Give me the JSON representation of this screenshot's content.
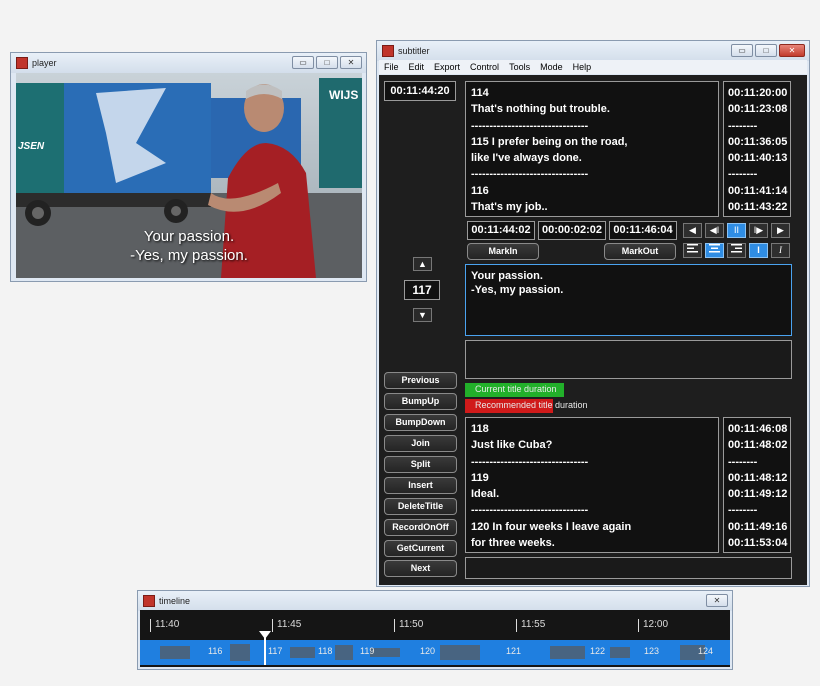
{
  "player": {
    "title": "player",
    "subtitle_lines": [
      "Your passion.",
      "-Yes, my passion."
    ],
    "truck_sign_1": "JSEN",
    "truck_sign_2": "WIJS"
  },
  "subtitler": {
    "title": "subtitler",
    "menu": [
      "File",
      "Edit",
      "Export",
      "Control",
      "Tools",
      "Mode",
      "Help"
    ],
    "current_time": "00:11:44:20",
    "prev_text_lines": [
      "114",
      "That's nothing but trouble.",
      "--------------------------------",
      "115 I prefer being on the road,",
      "like I've always done.",
      "--------------------------------",
      "116",
      "That's my job.."
    ],
    "prev_timecodes": [
      "00:11:20:00",
      "00:11:23:08",
      "--------",
      "00:11:36:05",
      "00:11:40:13",
      "--------",
      "00:11:41:14",
      "00:11:43:22"
    ],
    "mark_in": "00:11:44:02",
    "duration": "00:00:02:02",
    "mark_out": "00:11:46:04",
    "markin_label": "MarkIn",
    "markout_label": "MarkOut",
    "transport_icons": [
      "◀",
      "◀I",
      "II",
      "I▶",
      "▶"
    ],
    "align_icons": [
      "align-left-icon",
      "align-center-icon",
      "align-right-icon",
      "bold-icon",
      "italic-icon"
    ],
    "title_number": "117",
    "edit_text": "Your passion.\n-Yes, my passion.",
    "current_duration_label": "Current title duration",
    "recommended_duration_label": "Recommended title duration",
    "current_duration_fraction": 0.62,
    "recommended_duration_fraction": 0.88,
    "buttons": [
      "Previous",
      "BumpUp",
      "BumpDown",
      "Join",
      "Split",
      "Insert",
      "DeleteTitle",
      "RecordOnOff",
      "GetCurrent",
      "Next"
    ],
    "next_text_lines": [
      "118",
      "Just like Cuba?",
      "--------------------------------",
      "119",
      "Ideal.",
      "--------------------------------",
      "120 In four weeks I leave again",
      "for three weeks."
    ],
    "next_timecodes": [
      "00:11:46:08",
      "00:11:48:02",
      "--------",
      "00:11:48:12",
      "00:11:49:12",
      "--------",
      "00:11:49:16",
      "00:11:53:04"
    ],
    "colors": {
      "current_bar": "#22b02a",
      "recommended_bar": "#d01a1a",
      "accent": "#2f8de4"
    }
  },
  "timeline": {
    "title": "timeline",
    "ticks": [
      "11:40",
      "11:45",
      "11:50",
      "11:55",
      "12:00"
    ],
    "segments": [
      "116",
      "117",
      "118",
      "119",
      "120",
      "121",
      "122",
      "123",
      "124"
    ]
  }
}
